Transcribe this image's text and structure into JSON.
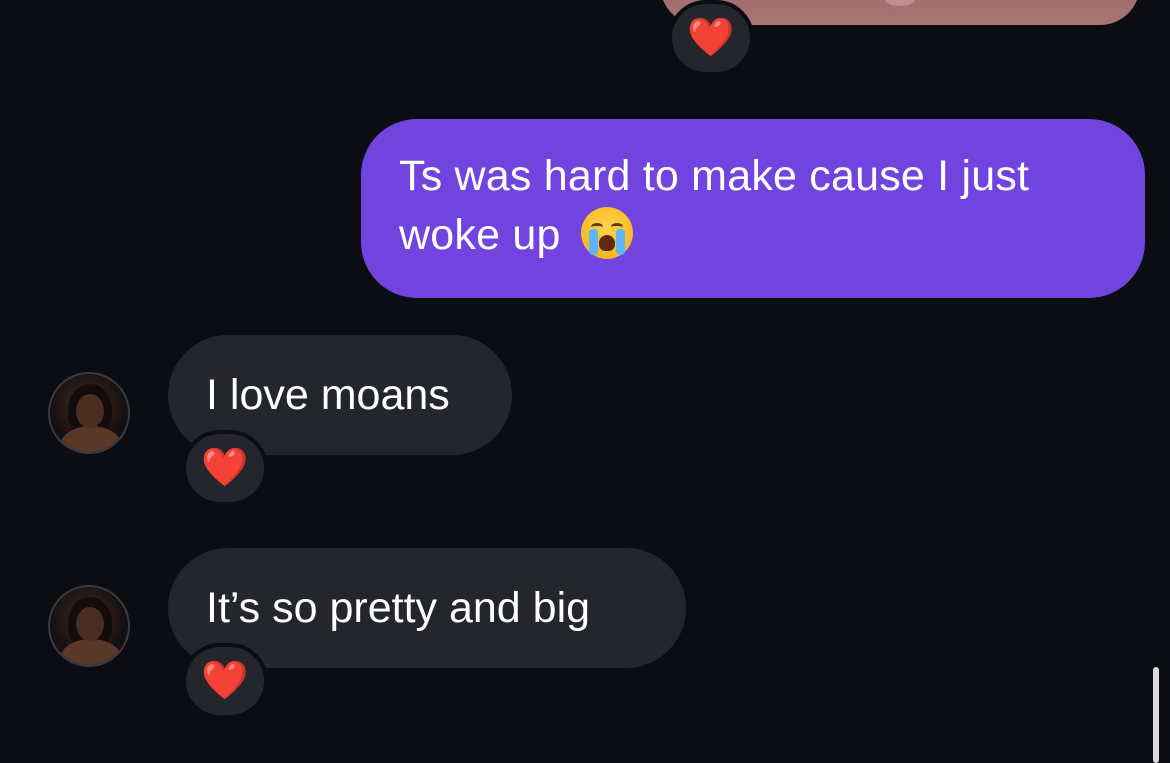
{
  "conversation": {
    "messages": [
      {
        "type": "image",
        "direction": "outgoing",
        "reaction": "❤️"
      },
      {
        "type": "text",
        "direction": "outgoing",
        "text_line1": "Ts was hard to make cause I just",
        "text_line2": "woke up",
        "emoji": "loudly-crying-face"
      },
      {
        "type": "text",
        "direction": "incoming",
        "text": "I love moans",
        "reaction": "❤️"
      },
      {
        "type": "text",
        "direction": "incoming",
        "text": "It’s so pretty and big",
        "reaction": "❤️"
      }
    ]
  },
  "colors": {
    "background": "#0c0d12",
    "sent_bubble": "#7144e0",
    "received_bubble": "#25262b",
    "reaction_heart": "#e8322f"
  }
}
